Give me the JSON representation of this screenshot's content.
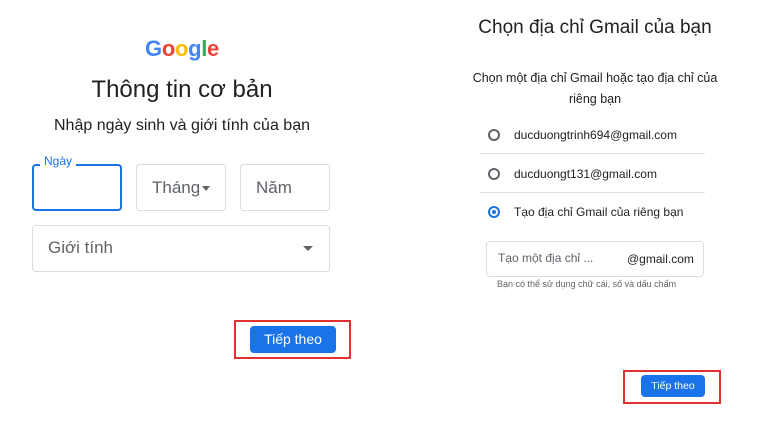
{
  "left": {
    "logo": {
      "letters": [
        "G",
        "o",
        "o",
        "g",
        "l",
        "e"
      ],
      "colors": [
        "#4285f4",
        "#ea4335",
        "#fbbc05",
        "#4285f4",
        "#34a853",
        "#ea4335"
      ]
    },
    "title": "Thông tin cơ bản",
    "subtitle": "Nhập ngày sinh và giới tính của bạn",
    "day_label": "Ngày",
    "month_placeholder": "Tháng",
    "year_placeholder": "Năm",
    "gender_placeholder": "Giới tính",
    "next_label": "Tiếp theo"
  },
  "right": {
    "title": "Chọn địa chỉ Gmail của bạn",
    "subtitle": "Chọn một địa chỉ Gmail hoặc tạo địa chỉ của riêng bạn",
    "options": [
      {
        "label": "ducduongtrinh694@gmail.com",
        "selected": false
      },
      {
        "label": "ducduongt131@gmail.com",
        "selected": false
      },
      {
        "label": "Tạo địa chỉ Gmail của riêng bạn",
        "selected": true
      }
    ],
    "username_placeholder": "Tạo một địa chỉ ...",
    "domain_suffix": "@gmail.com",
    "hint": "Bạn có thể sử dụng chữ cái, số và dấu chấm",
    "next_label": "Tiếp theo"
  },
  "colors": {
    "accent": "#1a73e8",
    "highlight_box": "#e03131"
  }
}
